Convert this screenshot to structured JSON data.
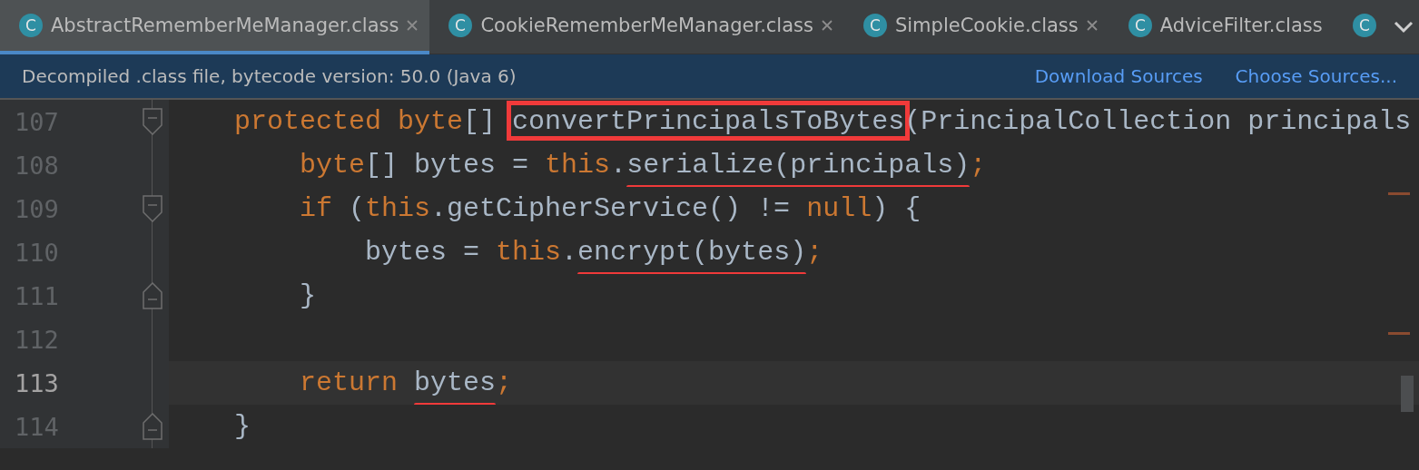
{
  "tabs": [
    {
      "icon": "C",
      "label": "AbstractRememberMeManager.class",
      "selected": true,
      "closable": true
    },
    {
      "icon": "C",
      "label": "CookieRememberMeManager.class",
      "selected": false,
      "closable": true
    },
    {
      "icon": "C",
      "label": "SimpleCookie.class",
      "selected": false,
      "closable": true
    },
    {
      "icon": "C",
      "label": "AdviceFilter.class",
      "selected": false,
      "closable": false
    },
    {
      "icon": "C",
      "selected": false,
      "closable": false
    }
  ],
  "banner": {
    "message": "Decompiled .class file, bytecode version: 50.0 (Java 6)",
    "links": [
      "Download Sources",
      "Choose Sources..."
    ]
  },
  "editor": {
    "lines": [
      {
        "number": "107",
        "current": false,
        "fold_start": true,
        "fold_end": false,
        "tokens": [
          {
            "kind": "keyword",
            "text": "    protected byte"
          },
          {
            "kind": "plain",
            "text": "[] "
          },
          {
            "kind": "plain",
            "text": "convertPrincipalsToBytes",
            "boxed": true
          },
          {
            "kind": "plain",
            "text": "(PrincipalCollection principals"
          }
        ]
      },
      {
        "number": "108",
        "current": false,
        "fold_start": false,
        "fold_end": false,
        "tokens": [
          {
            "kind": "keyword",
            "text": "        byte"
          },
          {
            "kind": "plain",
            "text": "[] bytes = "
          },
          {
            "kind": "keyword",
            "text": "this"
          },
          {
            "kind": "plain",
            "text": "."
          },
          {
            "kind": "plain",
            "text": "serialize(principals)",
            "underlined": true
          },
          {
            "kind": "keyword",
            "text": ";"
          }
        ]
      },
      {
        "number": "109",
        "current": false,
        "fold_start": true,
        "fold_end": false,
        "tokens": [
          {
            "kind": "keyword",
            "text": "        if"
          },
          {
            "kind": "plain",
            "text": " ("
          },
          {
            "kind": "keyword",
            "text": "this"
          },
          {
            "kind": "plain",
            "text": ".getCipherService() != "
          },
          {
            "kind": "keyword",
            "text": "null"
          },
          {
            "kind": "plain",
            "text": ") {"
          }
        ]
      },
      {
        "number": "110",
        "current": false,
        "fold_start": false,
        "fold_end": false,
        "tokens": [
          {
            "kind": "plain",
            "text": "            bytes = "
          },
          {
            "kind": "keyword",
            "text": "this"
          },
          {
            "kind": "plain",
            "text": "."
          },
          {
            "kind": "plain",
            "text": "encrypt(bytes)",
            "underlined": true
          },
          {
            "kind": "keyword",
            "text": ";"
          }
        ]
      },
      {
        "number": "111",
        "current": false,
        "fold_start": false,
        "fold_end": true,
        "tokens": [
          {
            "kind": "plain",
            "text": "        }"
          }
        ]
      },
      {
        "number": "112",
        "current": false,
        "fold_start": false,
        "fold_end": false
      },
      {
        "number": "113",
        "current": true,
        "fold_start": false,
        "fold_end": false,
        "tokens": [
          {
            "kind": "keyword",
            "text": "        return "
          },
          {
            "kind": "plain",
            "text": "bytes",
            "underlined": true
          },
          {
            "kind": "keyword",
            "text": ";"
          }
        ]
      },
      {
        "number": "114",
        "current": false,
        "fold_start": false,
        "fold_end": true,
        "tokens": [
          {
            "kind": "plain",
            "text": "    }"
          }
        ]
      }
    ]
  }
}
